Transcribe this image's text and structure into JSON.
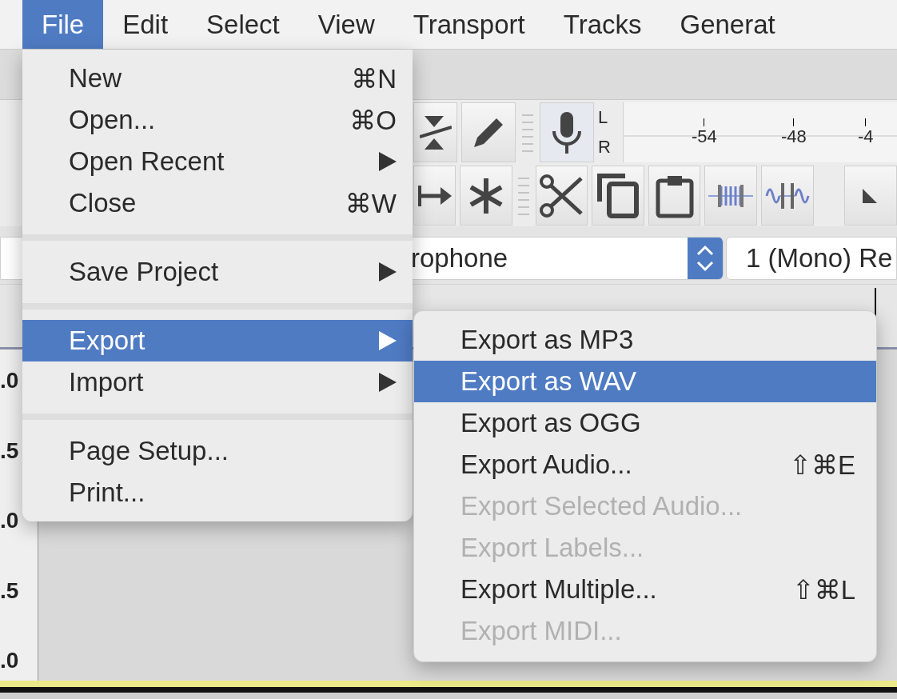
{
  "menubar": [
    {
      "label": "File",
      "selected": true
    },
    {
      "label": "Edit",
      "selected": false
    },
    {
      "label": "Select",
      "selected": false
    },
    {
      "label": "View",
      "selected": false
    },
    {
      "label": "Transport",
      "selected": false
    },
    {
      "label": "Tracks",
      "selected": false
    },
    {
      "label": "Generat",
      "selected": false
    }
  ],
  "meter": {
    "channels": [
      "L",
      "R"
    ],
    "ticks": [
      "-54",
      "-48",
      "-4"
    ]
  },
  "device_bar": {
    "input_device": "rophone",
    "input_channels": "1 (Mono) Re"
  },
  "track": {
    "scale": [
      ".0",
      ".5",
      ".0",
      ".5",
      ".0"
    ]
  },
  "file_menu": {
    "items": [
      {
        "kind": "item",
        "label": "New",
        "shortcut": "⌘N",
        "submenu": false,
        "selected": false
      },
      {
        "kind": "item",
        "label": "Open...",
        "shortcut": "⌘O",
        "submenu": false,
        "selected": false
      },
      {
        "kind": "item",
        "label": "Open Recent",
        "submenu": true,
        "selected": false
      },
      {
        "kind": "item",
        "label": "Close",
        "shortcut": "⌘W",
        "submenu": false,
        "selected": false
      },
      {
        "kind": "separator"
      },
      {
        "kind": "item",
        "label": "Save Project",
        "submenu": true,
        "selected": false
      },
      {
        "kind": "separator"
      },
      {
        "kind": "item",
        "label": "Export",
        "submenu": true,
        "selected": true
      },
      {
        "kind": "item",
        "label": "Import",
        "submenu": true,
        "selected": false
      },
      {
        "kind": "separator"
      },
      {
        "kind": "item",
        "label": "Page Setup...",
        "submenu": false,
        "selected": false
      },
      {
        "kind": "item",
        "label": "Print...",
        "submenu": false,
        "selected": false
      }
    ]
  },
  "export_submenu": {
    "items": [
      {
        "label": "Export as MP3",
        "disabled": false,
        "selected": false
      },
      {
        "label": "Export as WAV",
        "disabled": false,
        "selected": true
      },
      {
        "label": "Export as OGG",
        "disabled": false,
        "selected": false
      },
      {
        "label": "Export Audio...",
        "shortcut": "⇧⌘E",
        "disabled": false,
        "selected": false
      },
      {
        "label": "Export Selected Audio...",
        "disabled": true,
        "selected": false
      },
      {
        "label": "Export Labels...",
        "disabled": true,
        "selected": false
      },
      {
        "label": "Export Multiple...",
        "shortcut": "⇧⌘L",
        "disabled": false,
        "selected": false
      },
      {
        "label": "Export MIDI...",
        "disabled": true,
        "selected": false
      }
    ]
  }
}
